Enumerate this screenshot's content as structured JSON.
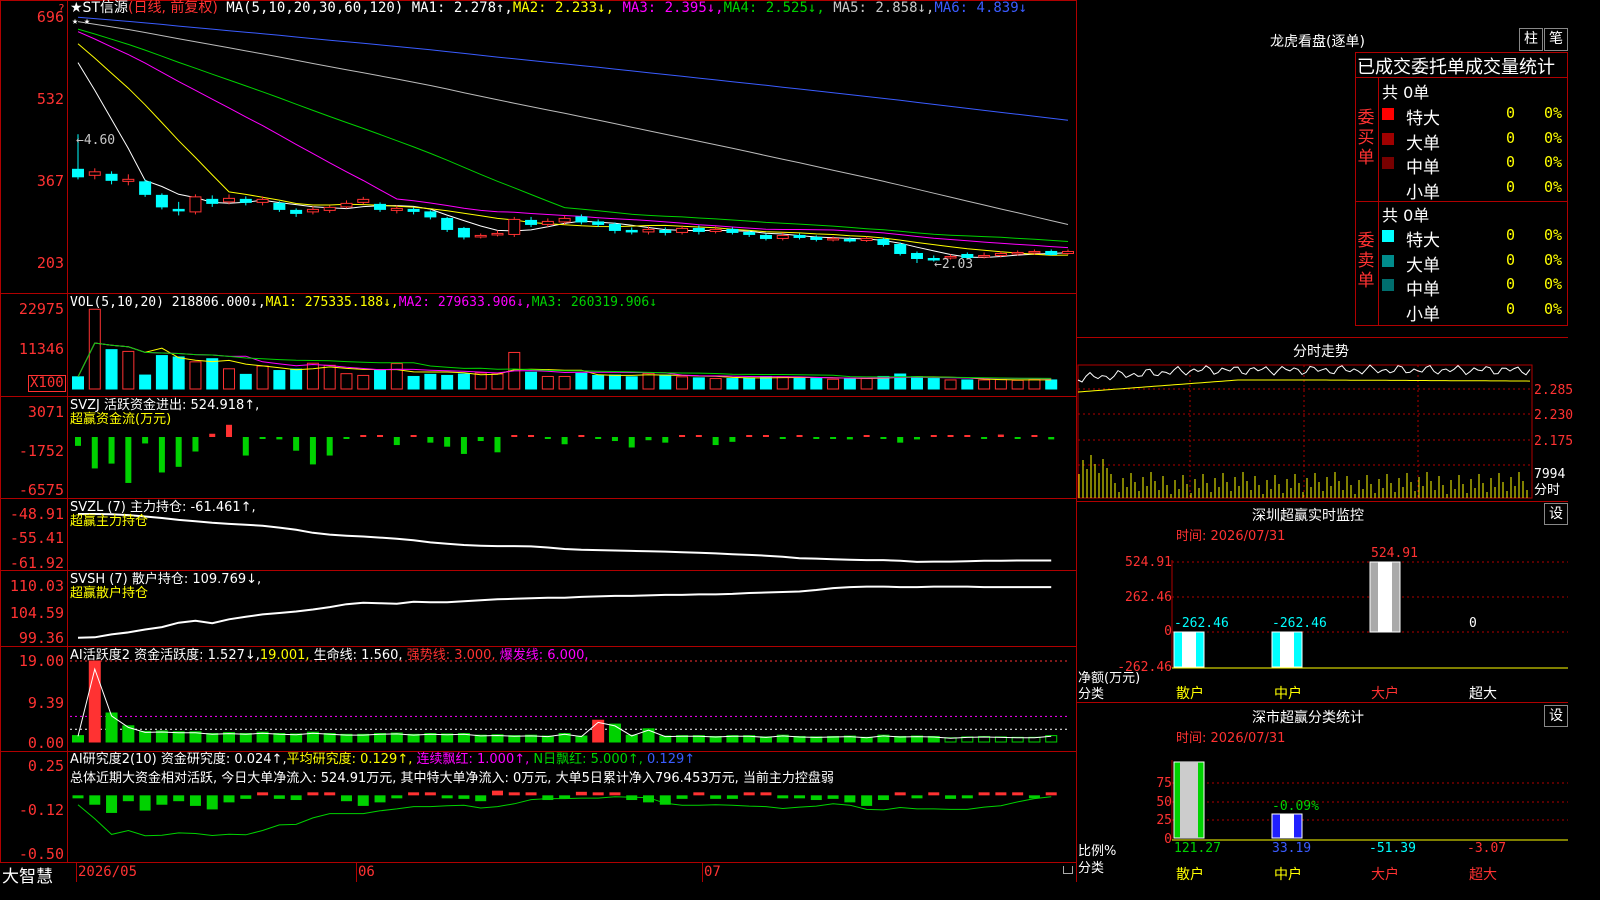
{
  "stock": {
    "name_line": "★ST信源",
    "period": "(日线, 前复权)",
    "ma_params": "MA(5,10,20,30,60,120)",
    "ma1": "MA1: 2.278↑,",
    "ma2": "MA2: 2.233↓,",
    "ma3": "MA3: 2.395↓,",
    "ma4": "MA4: 2.525↓,",
    "ma5": "MA5: 2.858↓,",
    "ma6": "MA6: 4.839↓",
    "high_mark": "4.60",
    "low_mark": "2.03",
    "stars": "★ ★"
  },
  "price_axis": [
    "696",
    "532",
    "367",
    "203"
  ],
  "vol": {
    "params": "VOL(5,10,20)",
    "value": "218806.000↓,",
    "ma1": "MA1: 275335.188↓,",
    "ma2": "MA2: 279633.906↓,",
    "ma3": "MA3: 260319.906↓",
    "axis": [
      "22975",
      "11346"
    ],
    "unit": "X100"
  },
  "svzj": {
    "line1": "SVZJ  活跃资金进出: 524.918↑,",
    "line2": "超赢资金流(万元)",
    "axis": [
      "3071",
      "-1752",
      "-6575"
    ]
  },
  "svzl": {
    "line1": "SVZL (7) 主力持仓: -61.461↑,",
    "line2": "超赢主力持仓",
    "axis": [
      "-48.91",
      "-55.41",
      "-61.92"
    ]
  },
  "svsh": {
    "line1": "SVSH (7) 散户持仓: 109.769↓,",
    "line2": "超赢散户持仓",
    "axis": [
      "110.03",
      "104.59",
      "99.36"
    ]
  },
  "ai1": {
    "name": "AI活跃度2",
    "a": "资金活跃度: 1.527↓,",
    "b": "19.001,",
    "c": "生命线: 1.560,",
    "d": "强势线: 3.000,",
    "e": "爆发线: 6.000,",
    "axis": [
      "19.00",
      "9.39",
      "0.00"
    ]
  },
  "ai2": {
    "name": "AI研究度2(10)",
    "a": "资金研究度: 0.024↑,",
    "b": "平均研究度: 0.129↑,",
    "c": "连续飘红: 1.000↑,",
    "d": "N日飘红: 5.000↑,",
    "e": "0.129↑",
    "desc": "总体近期大资金相对活跃, 今日大单净流入: 524.91万元, 其中特大单净流入: 0万元, 大单5日累计净入796.453万元, 当前主力控盘弱",
    "axis": [
      "0.25",
      "-0.12",
      "-0.50"
    ]
  },
  "date_axis": [
    "2026/05",
    "06",
    "07"
  ],
  "brand": "大智慧",
  "dragon": {
    "title": "龙虎看盘(逐单)",
    "btn1": "柱",
    "btn2": "笔",
    "header": "已成交委托单成交量统计",
    "buy_group": "委买单",
    "sell_group": "委卖单",
    "buy_total": "共 0单",
    "sell_total": "共 0单",
    "buy_rows": [
      {
        "name": "特大",
        "count": "0",
        "pct": "0%",
        "color": "#ff0000"
      },
      {
        "name": "大单",
        "count": "0",
        "pct": "0%",
        "color": "#a00000"
      },
      {
        "name": "中单",
        "count": "0",
        "pct": "0%",
        "color": "#780000"
      },
      {
        "name": "小单",
        "count": "0",
        "pct": "0%",
        "color": "#000000"
      }
    ],
    "sell_rows": [
      {
        "name": "特大",
        "count": "0",
        "pct": "0%",
        "color": "#00ffff"
      },
      {
        "name": "大单",
        "count": "0",
        "pct": "0%",
        "color": "#008c8c"
      },
      {
        "name": "中单",
        "count": "0",
        "pct": "0%",
        "color": "#006e6e"
      },
      {
        "name": "小单",
        "count": "0",
        "pct": "0%",
        "color": "#000000"
      }
    ]
  },
  "intraday": {
    "title": "分时走势",
    "axis": [
      "2.285",
      "2.230",
      "2.175"
    ],
    "vol_label": "7994",
    "unit": "分时"
  },
  "monitor": {
    "title": "深圳超赢实时监控",
    "btn": "设",
    "time": "时间: 2026/07/31",
    "axis": [
      "524.91",
      "262.46",
      "0",
      "-262.46"
    ],
    "ylabel": "净额(万元)",
    "xlabel": "分类",
    "bar_labels": [
      "-262.46",
      "-262.46",
      "524.91",
      "0"
    ],
    "cats": [
      "散户",
      "中户",
      "大户",
      "超大"
    ]
  },
  "classify": {
    "title": "深市超赢分类统计",
    "btn": "设",
    "time": "时间: 2026/07/31",
    "axis": [
      "75",
      "50",
      "25",
      "0"
    ],
    "ylabel": "比例%",
    "xlabel": "分类",
    "pct_label": "-0.09%",
    "values": [
      "121.27",
      "33.19",
      "-51.39",
      "-3.07"
    ],
    "cats": [
      "散户",
      "中户",
      "大户",
      "超大"
    ]
  },
  "chart_data": {
    "type": "candlestick",
    "candles": [
      {
        "o": 3.9,
        "c": 3.75,
        "h": 4.6,
        "l": 3.7
      },
      {
        "o": 3.78,
        "c": 3.85,
        "h": 3.92,
        "l": 3.7
      },
      {
        "o": 3.8,
        "c": 3.68,
        "h": 3.86,
        "l": 3.6
      },
      {
        "o": 3.66,
        "c": 3.7,
        "h": 3.8,
        "l": 3.58
      },
      {
        "o": 3.65,
        "c": 3.4,
        "h": 3.7,
        "l": 3.35
      },
      {
        "o": 3.38,
        "c": 3.15,
        "h": 3.42,
        "l": 3.1
      },
      {
        "o": 3.1,
        "c": 3.08,
        "h": 3.25,
        "l": 2.98
      },
      {
        "o": 3.05,
        "c": 3.35,
        "h": 3.4,
        "l": 3.0
      },
      {
        "o": 3.3,
        "c": 3.22,
        "h": 3.38,
        "l": 3.15
      },
      {
        "o": 3.25,
        "c": 3.32,
        "h": 3.4,
        "l": 3.2
      },
      {
        "o": 3.3,
        "c": 3.24,
        "h": 3.36,
        "l": 3.18
      },
      {
        "o": 3.24,
        "c": 3.3,
        "h": 3.36,
        "l": 3.18
      },
      {
        "o": 3.22,
        "c": 3.1,
        "h": 3.26,
        "l": 3.05
      },
      {
        "o": 3.08,
        "c": 3.02,
        "h": 3.12,
        "l": 2.95
      },
      {
        "o": 3.05,
        "c": 3.1,
        "h": 3.16,
        "l": 3.0
      },
      {
        "o": 3.08,
        "c": 3.14,
        "h": 3.18,
        "l": 3.03
      },
      {
        "o": 3.15,
        "c": 3.22,
        "h": 3.28,
        "l": 3.12
      },
      {
        "o": 3.24,
        "c": 3.3,
        "h": 3.35,
        "l": 3.2
      },
      {
        "o": 3.2,
        "c": 3.1,
        "h": 3.24,
        "l": 3.05
      },
      {
        "o": 3.08,
        "c": 3.12,
        "h": 3.18,
        "l": 3.02
      },
      {
        "o": 3.1,
        "c": 3.06,
        "h": 3.14,
        "l": 3.0
      },
      {
        "o": 3.05,
        "c": 2.95,
        "h": 3.08,
        "l": 2.9
      },
      {
        "o": 2.92,
        "c": 2.7,
        "h": 2.95,
        "l": 2.65
      },
      {
        "o": 2.72,
        "c": 2.55,
        "h": 2.75,
        "l": 2.5
      },
      {
        "o": 2.55,
        "c": 2.58,
        "h": 2.62,
        "l": 2.52
      },
      {
        "o": 2.6,
        "c": 2.62,
        "h": 2.68,
        "l": 2.56
      },
      {
        "o": 2.6,
        "c": 2.9,
        "h": 2.95,
        "l": 2.55
      },
      {
        "o": 2.88,
        "c": 2.8,
        "h": 2.95,
        "l": 2.75
      },
      {
        "o": 2.8,
        "c": 2.86,
        "h": 2.92,
        "l": 2.75
      },
      {
        "o": 2.85,
        "c": 2.92,
        "h": 2.98,
        "l": 2.8
      },
      {
        "o": 2.95,
        "c": 2.85,
        "h": 3.0,
        "l": 2.8
      },
      {
        "o": 2.85,
        "c": 2.8,
        "h": 2.9,
        "l": 2.75
      },
      {
        "o": 2.8,
        "c": 2.68,
        "h": 2.84,
        "l": 2.62
      },
      {
        "o": 2.68,
        "c": 2.66,
        "h": 2.74,
        "l": 2.6
      },
      {
        "o": 2.65,
        "c": 2.7,
        "h": 2.76,
        "l": 2.6
      },
      {
        "o": 2.68,
        "c": 2.64,
        "h": 2.74,
        "l": 2.58
      },
      {
        "o": 2.64,
        "c": 2.72,
        "h": 2.78,
        "l": 2.6
      },
      {
        "o": 2.72,
        "c": 2.66,
        "h": 2.78,
        "l": 2.6
      },
      {
        "o": 2.66,
        "c": 2.7,
        "h": 2.76,
        "l": 2.62
      },
      {
        "o": 2.7,
        "c": 2.64,
        "h": 2.74,
        "l": 2.6
      },
      {
        "o": 2.64,
        "c": 2.6,
        "h": 2.68,
        "l": 2.55
      },
      {
        "o": 2.58,
        "c": 2.52,
        "h": 2.62,
        "l": 2.48
      },
      {
        "o": 2.52,
        "c": 2.58,
        "h": 2.64,
        "l": 2.48
      },
      {
        "o": 2.58,
        "c": 2.54,
        "h": 2.62,
        "l": 2.5
      },
      {
        "o": 2.54,
        "c": 2.5,
        "h": 2.58,
        "l": 2.46
      },
      {
        "o": 2.5,
        "c": 2.52,
        "h": 2.56,
        "l": 2.46
      },
      {
        "o": 2.5,
        "c": 2.47,
        "h": 2.54,
        "l": 2.44
      },
      {
        "o": 2.48,
        "c": 2.52,
        "h": 2.56,
        "l": 2.45
      },
      {
        "o": 2.5,
        "c": 2.4,
        "h": 2.54,
        "l": 2.36
      },
      {
        "o": 2.4,
        "c": 2.22,
        "h": 2.44,
        "l": 2.18
      },
      {
        "o": 2.22,
        "c": 2.12,
        "h": 2.26,
        "l": 2.03
      },
      {
        "o": 2.12,
        "c": 2.1,
        "h": 2.18,
        "l": 2.06
      },
      {
        "o": 2.14,
        "c": 2.16,
        "h": 2.2,
        "l": 2.1
      },
      {
        "o": 2.2,
        "c": 2.14,
        "h": 2.24,
        "l": 2.1
      },
      {
        "o": 2.15,
        "c": 2.18,
        "h": 2.24,
        "l": 2.12
      },
      {
        "o": 2.18,
        "c": 2.22,
        "h": 2.26,
        "l": 2.14
      },
      {
        "o": 2.22,
        "c": 2.24,
        "h": 2.28,
        "l": 2.18
      },
      {
        "o": 2.24,
        "c": 2.26,
        "h": 2.3,
        "l": 2.2
      },
      {
        "o": 2.26,
        "c": 2.2,
        "h": 2.3,
        "l": 2.18
      },
      {
        "o": 2.22,
        "c": 2.26,
        "h": 2.3,
        "l": 2.2
      }
    ],
    "volume": [
      3500,
      22900,
      11300,
      10800,
      4000,
      9600,
      9200,
      7800,
      8700,
      5800,
      4200,
      6600,
      5300,
      5700,
      7400,
      6800,
      4400,
      3900,
      5400,
      7300,
      3600,
      4200,
      3900,
      4300,
      4600,
      4300,
      10500,
      4800,
      3600,
      3600,
      4500,
      3900,
      4000,
      3500,
      4500,
      4000,
      3500,
      3200,
      3000,
      3000,
      3200,
      3600,
      3500,
      3200,
      3000,
      2800,
      3100,
      3000,
      3600,
      4300,
      3500,
      3000,
      2600,
      2600,
      2600,
      2700,
      2500,
      2700,
      2600
    ],
    "svzj": [
      -1100,
      -3900,
      -3300,
      -5700,
      -800,
      -4400,
      -3700,
      -1800,
      400,
      1500,
      -2300,
      -100,
      -300,
      -1700,
      -3400,
      -2300,
      -200,
      0,
      0,
      -1000,
      0,
      -700,
      -1200,
      -2100,
      -500,
      -1900,
      0,
      0,
      -200,
      -900,
      0,
      -100,
      -500,
      -1300,
      -400,
      -700,
      0,
      0,
      -1000,
      -600,
      0,
      0,
      -200,
      0,
      -100,
      -100,
      -300,
      0,
      -100,
      -700,
      -300,
      0,
      0,
      0,
      -200,
      300,
      -200,
      0,
      -300
    ],
    "svzl": [
      -48.9,
      -48.9,
      -49.0,
      -49.2,
      -49.6,
      -50.0,
      -50.5,
      -50.9,
      -51.3,
      -51.6,
      -51.8,
      -52.1,
      -52.6,
      -53.2,
      -54.0,
      -54.5,
      -54.8,
      -55.0,
      -55.3,
      -55.6,
      -56.0,
      -56.6,
      -57.0,
      -57.3,
      -57.5,
      -57.6,
      -57.6,
      -57.7,
      -58.0,
      -58.4,
      -58.6,
      -58.7,
      -58.8,
      -58.9,
      -59.0,
      -59.1,
      -59.3,
      -59.4,
      -59.6,
      -59.8,
      -60.0,
      -60.2,
      -60.5,
      -60.9,
      -61.0,
      -61.2,
      -61.3,
      -61.4,
      -61.4,
      -61.6,
      -61.9,
      -61.8,
      -61.8,
      -61.7,
      -61.6,
      -61.6,
      -61.5,
      -61.5,
      -61.5
    ],
    "svsh": [
      99.4,
      99.5,
      100.1,
      100.5,
      101.1,
      101.6,
      102.5,
      102.9,
      102.4,
      103.2,
      103.7,
      104.2,
      104.5,
      104.8,
      105.2,
      105.7,
      106.3,
      106.6,
      106.5,
      106.4,
      106.8,
      106.7,
      106.7,
      106.9,
      107.1,
      107.3,
      107.4,
      107.5,
      107.6,
      107.6,
      107.8,
      107.9,
      108.0,
      108.0,
      108.1,
      108.2,
      108.2,
      108.3,
      108.3,
      108.4,
      108.6,
      108.7,
      108.8,
      108.9,
      109.2,
      109.6,
      109.8,
      109.9,
      109.9,
      109.8,
      109.8,
      109.9,
      109.9,
      109.9,
      109.8,
      109.8,
      109.8,
      109.8,
      109.8
    ],
    "ai1": [
      1.5,
      19.0,
      6.8,
      3.8,
      2.5,
      2.6,
      2.4,
      2.4,
      2.0,
      2.2,
      2.0,
      2.3,
      2.0,
      1.9,
      2.3,
      2.0,
      1.8,
      1.8,
      2.0,
      2.1,
      1.8,
      2.0,
      1.9,
      2.0,
      1.6,
      1.7,
      1.5,
      1.6,
      1.4,
      2.0,
      1.4,
      5.1,
      4.2,
      1.6,
      3.1,
      1.4,
      1.5,
      1.5,
      1.3,
      1.5,
      1.5,
      1.2,
      1.6,
      1.3,
      1.2,
      1.3,
      1.4,
      1.1,
      1.6,
      1.3,
      1.4,
      1.3,
      1.0,
      1.2,
      1.3,
      1.2,
      1.1,
      1.1,
      1.5
    ],
    "ai2": [
      -0.02,
      -0.08,
      -0.15,
      -0.05,
      -0.13,
      -0.08,
      -0.05,
      -0.09,
      -0.12,
      -0.06,
      -0.03,
      0.01,
      -0.03,
      -0.04,
      0.01,
      0.01,
      -0.05,
      -0.09,
      -0.06,
      -0.02,
      0.02,
      0.01,
      -0.01,
      -0.03,
      -0.05,
      0.04,
      0.01,
      0.0,
      -0.04,
      -0.02,
      0.03,
      0.01,
      0.02,
      -0.04,
      -0.06,
      -0.08,
      -0.03,
      0.0,
      -0.03,
      -0.03,
      0.01,
      0.0,
      -0.02,
      -0.01,
      -0.04,
      -0.03,
      -0.06,
      -0.09,
      -0.04,
      0.02,
      -0.02,
      0.0,
      -0.03,
      -0.01,
      0.01,
      0.0,
      0.02,
      -0.02,
      0.0
    ],
    "price_ylim": [
      2.03,
      6.96
    ]
  }
}
